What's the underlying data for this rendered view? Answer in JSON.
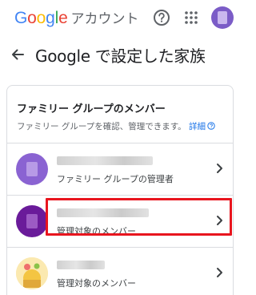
{
  "app": {
    "logo_text": "Google",
    "account_label": "アカウント",
    "help_icon": "help-circle-icon",
    "apps_icon": "apps-grid-icon",
    "accent": "#1a73e8"
  },
  "header": {
    "back_icon": "arrow-back-icon",
    "title": "Google で設定した家族"
  },
  "family_card": {
    "title": "ファミリー グループのメンバー",
    "description": "ファミリー グループを確認、管理できます。",
    "link_label": "詳細",
    "members": [
      {
        "role": "ファミリー グループの管理者",
        "avatar_color": "#7b5cc7"
      },
      {
        "role": "管理対象のメンバー",
        "avatar_color": "#6a1b9a"
      },
      {
        "role": "管理対象のメンバー",
        "avatar_color": "#f4d35e"
      }
    ]
  },
  "highlight": {
    "color": "#e8151e"
  }
}
